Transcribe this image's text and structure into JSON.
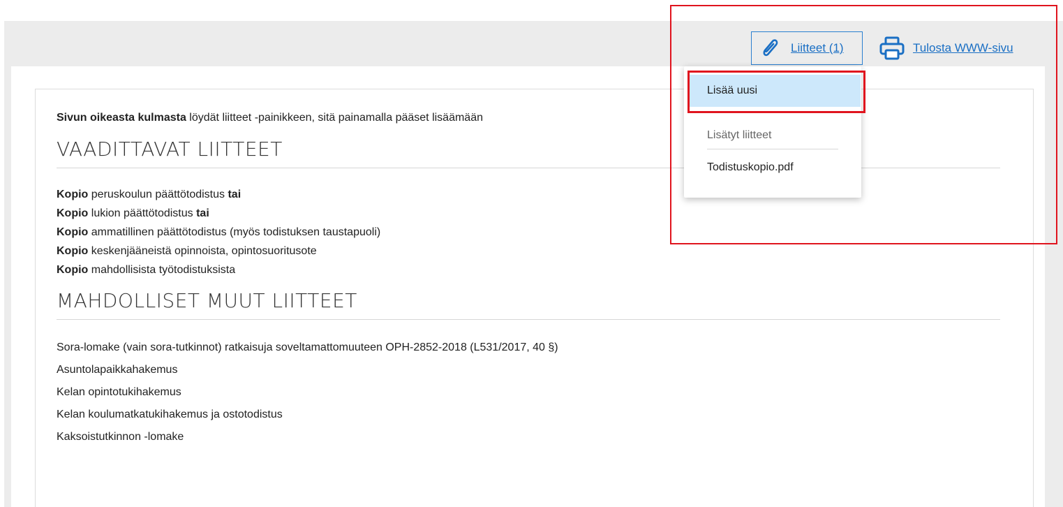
{
  "toolbar": {
    "attachments_label": "Liitteet (1)",
    "print_label": "Tulosta WWW-sivu"
  },
  "icons": {
    "attachment": "paperclip-icon",
    "print": "printer-icon"
  },
  "colors": {
    "link": "#1a6fc4",
    "highlight_border": "#e0141e",
    "menu_selected_bg": "#cde8fb"
  },
  "content": {
    "intro_bold": "Sivun oikeasta kulmasta",
    "intro_rest": " löydät liitteet -painikkeen, sitä painamalla pääset lisäämään",
    "required_heading": "VAADITTAVAT LIITTEET",
    "required_items": [
      {
        "bold": "Kopio",
        "text": " peruskoulun päättötodistus ",
        "tail_bold": "tai"
      },
      {
        "bold": "Kopio",
        "text": " lukion päättötodistus ",
        "tail_bold": "tai"
      },
      {
        "bold": "Kopio",
        "text": " ammatillinen päättötodistus (myös todistuksen taustapuoli)",
        "tail_bold": ""
      },
      {
        "bold": "Kopio",
        "text": " keskenjääneistä opinnoista, opintosuoritusote",
        "tail_bold": ""
      },
      {
        "bold": "Kopio",
        "text": " mahdollisista työtodistuksista",
        "tail_bold": ""
      }
    ],
    "other_heading": "MAHDOLLISET MUUT LIITTEET",
    "other_items": [
      "Sora-lomake (vain sora-tutkinnot) ratkaisuja soveltamattomuuteen OPH-2852-2018 (L531/2017, 40 §)",
      "Asuntolapaikkahakemus",
      "Kelan opintotukihakemus",
      "Kelan koulumatkatukihakemus ja ostotodistus",
      "Kaksoistutkinnon -lomake"
    ]
  },
  "dropdown": {
    "add_new": "Lisää uusi",
    "added_label": "Lisätyt liitteet",
    "files": [
      "Todistuskopio.pdf"
    ]
  }
}
